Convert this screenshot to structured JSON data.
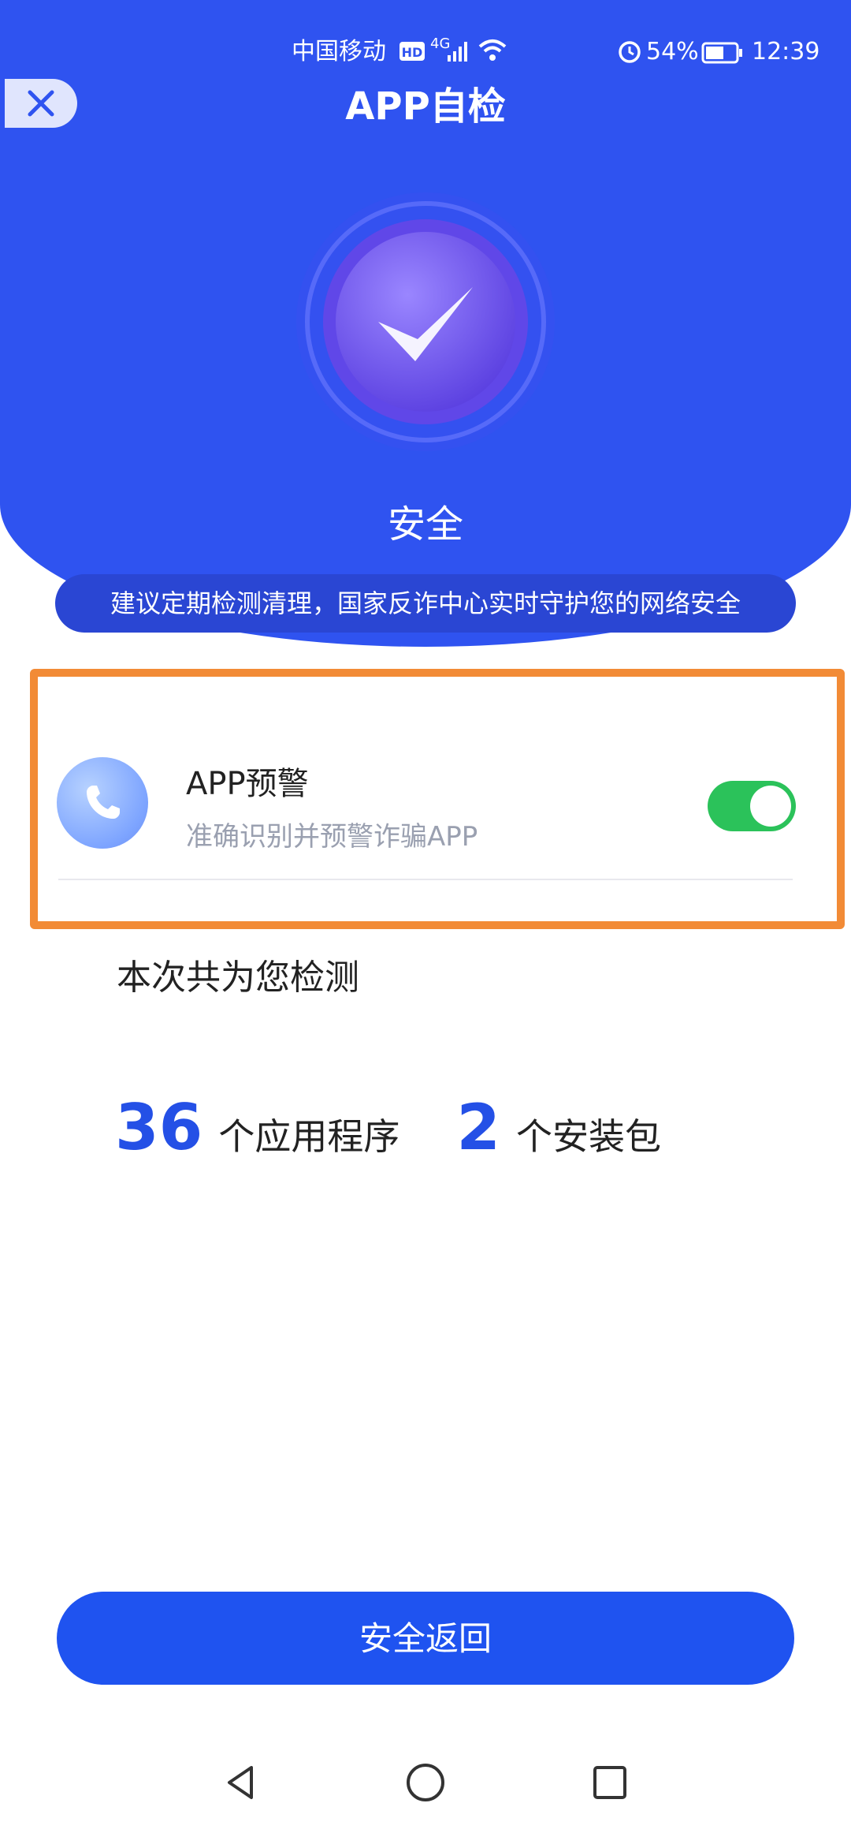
{
  "status_bar": {
    "carrier": "中国移动",
    "network": "4G",
    "battery": "54%",
    "time": "12:39"
  },
  "header": {
    "title": "APP自检",
    "close_icon": "close-icon"
  },
  "result": {
    "status": "安全",
    "tip": "建议定期检测清理，国家反诈中心实时守护您的网络安全"
  },
  "warning_card": {
    "title": "APP预警",
    "subtitle": "准确识别并预警诈骗APP",
    "toggle_on": true,
    "icon": "phone-icon"
  },
  "scan_summary": {
    "caption": "本次共为您检测",
    "apps_count": "36",
    "apps_unit": "个应用程序",
    "packages_count": "2",
    "packages_unit": "个安装包"
  },
  "actions": {
    "return_label": "安全返回"
  },
  "colors": {
    "brand_blue": "#2f53f0",
    "button_blue": "#1f53f0",
    "toggle_green": "#2bc25a",
    "highlight_orange": "#f28b36",
    "number_blue": "#2450e6"
  }
}
